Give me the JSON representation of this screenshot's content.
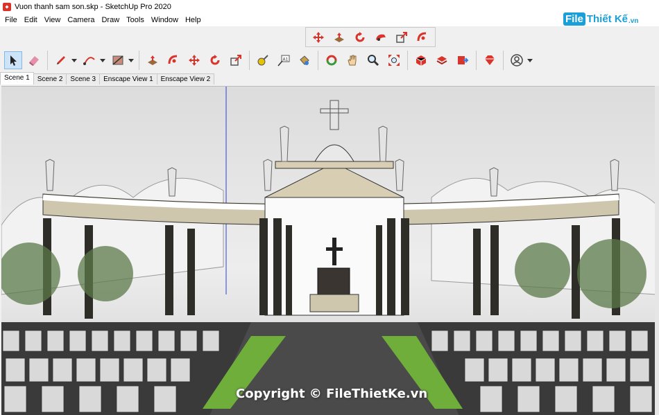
{
  "window": {
    "title": "Vuon thanh sam son.skp - SketchUp Pro 2020"
  },
  "menu": [
    "File",
    "Edit",
    "View",
    "Camera",
    "Draw",
    "Tools",
    "Window",
    "Help"
  ],
  "logo": {
    "box": "File",
    "text": "Thiết Kế",
    "suffix": ".vn"
  },
  "toolbar_top": [
    "move-icon",
    "push-pull-icon",
    "rotate-icon",
    "follow-me-icon",
    "scale-icon",
    "offset-icon"
  ],
  "toolbar_main": [
    "select-icon",
    "eraser-icon",
    "pencil-icon",
    "arc-icon",
    "rectangle-icon",
    "push-pull-icon",
    "offset-icon",
    "move-icon",
    "rotate-icon",
    "scale-icon",
    "tape-measure-icon",
    "text-icon",
    "paint-bucket-icon",
    "orbit-icon",
    "pan-icon",
    "zoom-icon",
    "zoom-extents-icon",
    "3d-warehouse-icon",
    "extension-warehouse-icon",
    "layout-icon",
    "ruby-icon",
    "user-icon"
  ],
  "tabs": [
    {
      "label": "Scene 1",
      "active": true
    },
    {
      "label": "Scene 2",
      "active": false
    },
    {
      "label": "Scene 3",
      "active": false
    },
    {
      "label": "Enscape View 1",
      "active": false
    },
    {
      "label": "Enscape View 2",
      "active": false
    }
  ],
  "watermark": "Copyright © FileThietKe.vn",
  "colors": {
    "accent": "#1a9fd8",
    "tool_red": "#d9342b",
    "active_tool": "#cde3f7"
  }
}
